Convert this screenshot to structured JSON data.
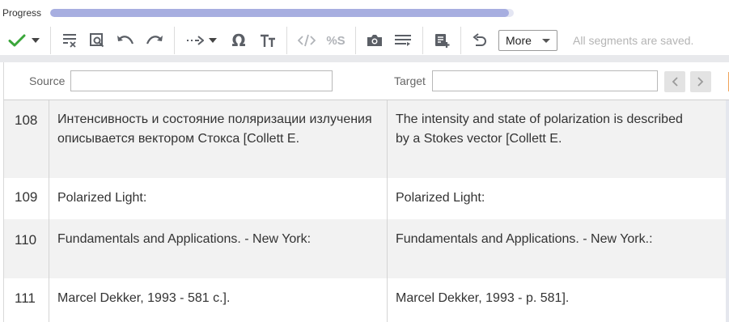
{
  "progress": {
    "label": "Progress",
    "fraction": 0.99
  },
  "toolbar": {
    "icons": [
      "confirm-check-icon",
      "dropdown-caret-icon",
      "clear-format-icon",
      "find-replace-icon",
      "undo-icon",
      "redo-icon",
      "insert-arrow-icon",
      "omega-special-char-icon",
      "text-case-icon",
      "tags-icon",
      "placeholder-icon",
      "screenshot-icon",
      "merge-segments-icon",
      "add-note-icon",
      "revert-icon"
    ],
    "more_label": "More",
    "status": "All segments are saved."
  },
  "filter": {
    "source_label": "Source",
    "source_value": "",
    "target_label": "Target",
    "target_value": ""
  },
  "colors": {
    "accent_check": "#3aa63a",
    "progress": "#a7aee0",
    "row_alt": "#f2f2f2"
  },
  "segments": [
    {
      "num": "108",
      "source": "Интенсивность и состояние поляризации излучения описывается вектором Стокса [Collett E.",
      "target": "The intensity and state of polarization is described by a Stokes vector [Collett E."
    },
    {
      "num": "109",
      "source": "Polarized Light:",
      "target": "Polarized Light:"
    },
    {
      "num": "110",
      "source": "Fundamentals and Applications. - New York:",
      "target": "Fundamentals and Applications. - New York.:"
    },
    {
      "num": "111",
      "source": "Marcel Dekker, 1993 - 581 с.].",
      "target": "Marcel Dekker, 1993 - p. 581]."
    }
  ]
}
